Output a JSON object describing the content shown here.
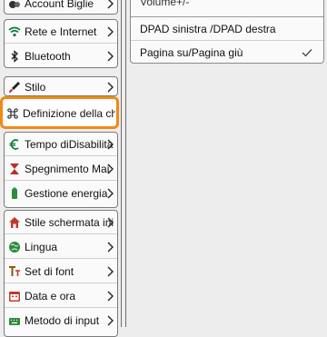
{
  "accounts": {
    "label": "Account Biglie"
  },
  "network": {
    "items": [
      {
        "label": "Rete e Internet",
        "icon": "wifi-icon"
      },
      {
        "label": "Bluetooth",
        "icon": "bluetooth-icon"
      }
    ]
  },
  "style": {
    "label": "Stilo",
    "icon": "brush-icon"
  },
  "shortcut_field": {
    "value": "Definizione della chi",
    "icon": "command-key-icon"
  },
  "power": {
    "items": [
      {
        "label": "Tempo diDisabilita",
        "icon": "euro-icon"
      },
      {
        "label": "Spegnimento  Mai",
        "icon": "hourglass-icon"
      },
      {
        "label": "Gestione energia",
        "icon": "battery-icon"
      }
    ]
  },
  "system": {
    "items": [
      {
        "label": "Stile schermata ini",
        "icon": "home-icon"
      },
      {
        "label": "Lingua",
        "icon": "globe-icon"
      },
      {
        "label": "Set di font",
        "icon": "font-icon"
      },
      {
        "label": "Data e ora",
        "icon": "calendar-icon"
      },
      {
        "label": "Metodo di input",
        "icon": "keyboard-icon"
      }
    ]
  },
  "right_panel": {
    "top_label": "Volume+/-",
    "items": [
      {
        "label": "DPAD sinistra /DPAD destra",
        "selected": false
      },
      {
        "label": "Pagina su/Pagina giù",
        "selected": true
      }
    ]
  },
  "colors": {
    "highlight": "#f08a12",
    "wifi": "#0a7a3a",
    "home": "#c0392b",
    "calendar": "#c0392b",
    "font": "#8a5a00",
    "battery": "#2e8b3d"
  }
}
